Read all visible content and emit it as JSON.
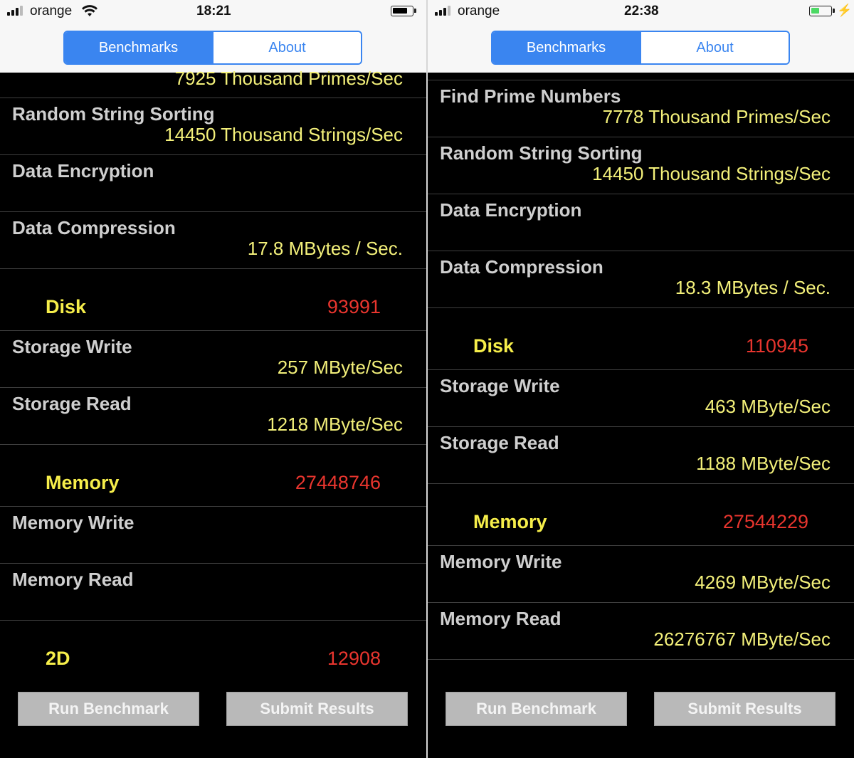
{
  "left": {
    "status": {
      "carrier": "orange",
      "time": "18:21",
      "battery_level": 0.8,
      "battery_color": "#000000"
    },
    "tabs": [
      "Benchmarks",
      "About"
    ],
    "active_tab": "Benchmarks",
    "partial_value": "7925 Thousand Primes/Sec",
    "rows_top": [
      {
        "name": "Random String Sorting",
        "value": "14450 Thousand Strings/Sec"
      },
      {
        "name": "Data Encryption",
        "value": ""
      },
      {
        "name": "Data Compression",
        "value": "17.8 MBytes / Sec."
      }
    ],
    "disk": {
      "label": "Disk",
      "score": "93991"
    },
    "disk_rows": [
      {
        "name": "Storage Write",
        "value": "257 MByte/Sec"
      },
      {
        "name": "Storage Read",
        "value": "1218 MByte/Sec"
      }
    ],
    "memory": {
      "label": "Memory",
      "score": "27448746"
    },
    "memory_rows": [
      {
        "name": "Memory Write",
        "value": ""
      },
      {
        "name": "Memory Read",
        "value": ""
      }
    ],
    "twod": {
      "label": "2D",
      "score": "12908"
    },
    "buttons": {
      "run": "Run Benchmark",
      "submit": "Submit Results"
    }
  },
  "right": {
    "status": {
      "carrier": "orange",
      "time": "22:38",
      "battery_level": 0.45,
      "battery_color": "#4cd964",
      "charging_icon": "bolt-icon"
    },
    "tabs": [
      "Benchmarks",
      "About"
    ],
    "active_tab": "Benchmarks",
    "rows_top": [
      {
        "name": "Find Prime Numbers",
        "value": "7778 Thousand Primes/Sec"
      },
      {
        "name": "Random String Sorting",
        "value": "14450 Thousand Strings/Sec"
      },
      {
        "name": "Data Encryption",
        "value": ""
      },
      {
        "name": "Data Compression",
        "value": "18.3 MBytes / Sec."
      }
    ],
    "disk": {
      "label": "Disk",
      "score": "110945"
    },
    "disk_rows": [
      {
        "name": "Storage Write",
        "value": "463 MByte/Sec"
      },
      {
        "name": "Storage Read",
        "value": "1188 MByte/Sec"
      }
    ],
    "memory": {
      "label": "Memory",
      "score": "27544229"
    },
    "memory_rows": [
      {
        "name": "Memory Write",
        "value": "4269 MByte/Sec"
      },
      {
        "name": "Memory Read",
        "value": "26276767 MByte/Sec"
      }
    ],
    "buttons": {
      "run": "Run Benchmark",
      "submit": "Submit Results"
    }
  },
  "colors": {
    "accent": "#3a85f0",
    "value_text": "#f3f07a",
    "category_text": "#f6ee4a",
    "score_text": "#e8352e",
    "row_label": "#cfcfcf"
  }
}
